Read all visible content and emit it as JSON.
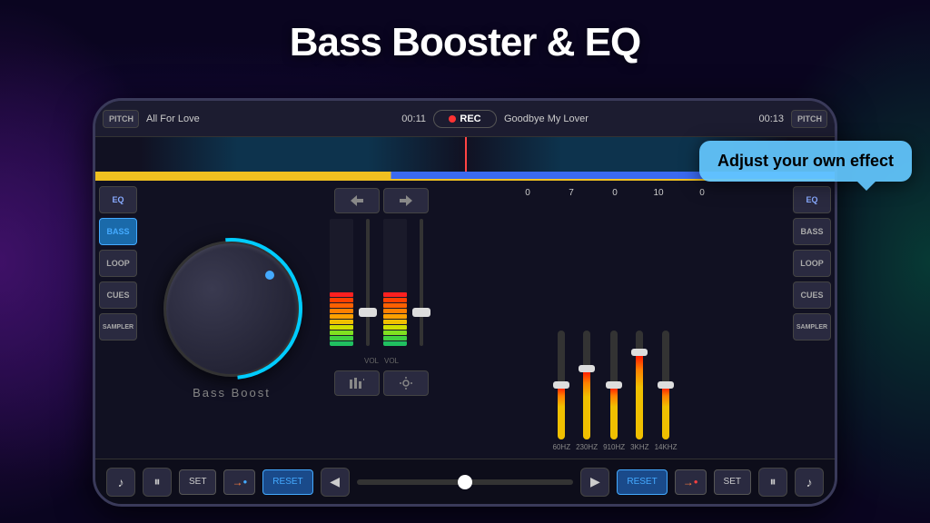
{
  "title": "Bass Booster & EQ",
  "tooltip": "Adjust your own effect",
  "topbar": {
    "pitch_label": "PITCH",
    "track_left_name": "All For Love",
    "track_left_time": "00:11",
    "rec_label": "REC",
    "track_right_name": "Goodbye My Lover",
    "track_right_time": "00:13"
  },
  "left_panel": {
    "buttons": [
      "EQ",
      "BASS",
      "LOOP",
      "CUES",
      "SAMPLER"
    ]
  },
  "right_panel": {
    "buttons": [
      "EQ",
      "BASS",
      "LOOP",
      "CUES",
      "SAMPLER"
    ]
  },
  "knob": {
    "label": "Bass  Boost"
  },
  "vu": {
    "vol_label_left": "VOL",
    "vol_label_right": "VOL"
  },
  "eq": {
    "values": [
      "0",
      "7",
      "0",
      "10",
      "0"
    ],
    "freqs": [
      "60HZ",
      "230HZ",
      "910HZ",
      "3KHZ",
      "14KHZ"
    ],
    "slider_positions": [
      50,
      65,
      50,
      80,
      50
    ]
  },
  "transport": {
    "music_icon_left": "♪",
    "pause_left": "⏸",
    "set_label": "SET",
    "arrow_label": "→",
    "reset_label": "RESET",
    "prev_label": "◀",
    "next_label": "▶",
    "reset_label_right": "RESET",
    "arrow_right": "→",
    "set_right": "SET",
    "pause_right": "⏸",
    "music_icon_right": "♪"
  }
}
